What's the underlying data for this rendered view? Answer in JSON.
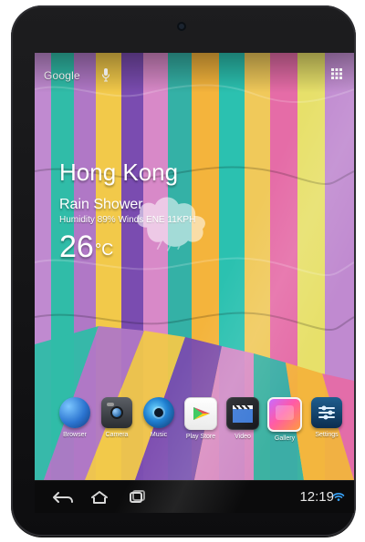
{
  "header": {
    "search_label": "Google",
    "mic_icon": "mic-icon",
    "apps_icon": "apps-grid-icon"
  },
  "weather": {
    "city": "Hong Kong",
    "condition": "Rain Shower",
    "details": "Humidity 89% Winds ENE 11KPH",
    "temperature": "26",
    "unit": "°C"
  },
  "dock": {
    "items": [
      {
        "label": "Browser",
        "icon": "browser-globe-icon"
      },
      {
        "label": "Camera",
        "icon": "camera-icon"
      },
      {
        "label": "Music",
        "icon": "music-icon"
      },
      {
        "label": "Play Store",
        "icon": "play-store-icon"
      },
      {
        "label": "Video",
        "icon": "video-clapper-icon"
      },
      {
        "label": "Gallery",
        "icon": "gallery-icon"
      },
      {
        "label": "Settings",
        "icon": "settings-icon"
      }
    ]
  },
  "system_bar": {
    "time": "12:19",
    "wifi_icon": "wifi-icon",
    "back_icon": "back-icon",
    "home_icon": "home-icon",
    "recents_icon": "recents-icon"
  },
  "colors": {
    "device_bezel": "#0d0d0f",
    "navbar": "#0b0b0c",
    "wallpaper_stripes": [
      "#b97cc9",
      "#2bb7a6",
      "#f1c73d",
      "#8e5bb6",
      "#f2a23a",
      "#de6aa0",
      "#a7d64a",
      "#f08a6b"
    ]
  }
}
